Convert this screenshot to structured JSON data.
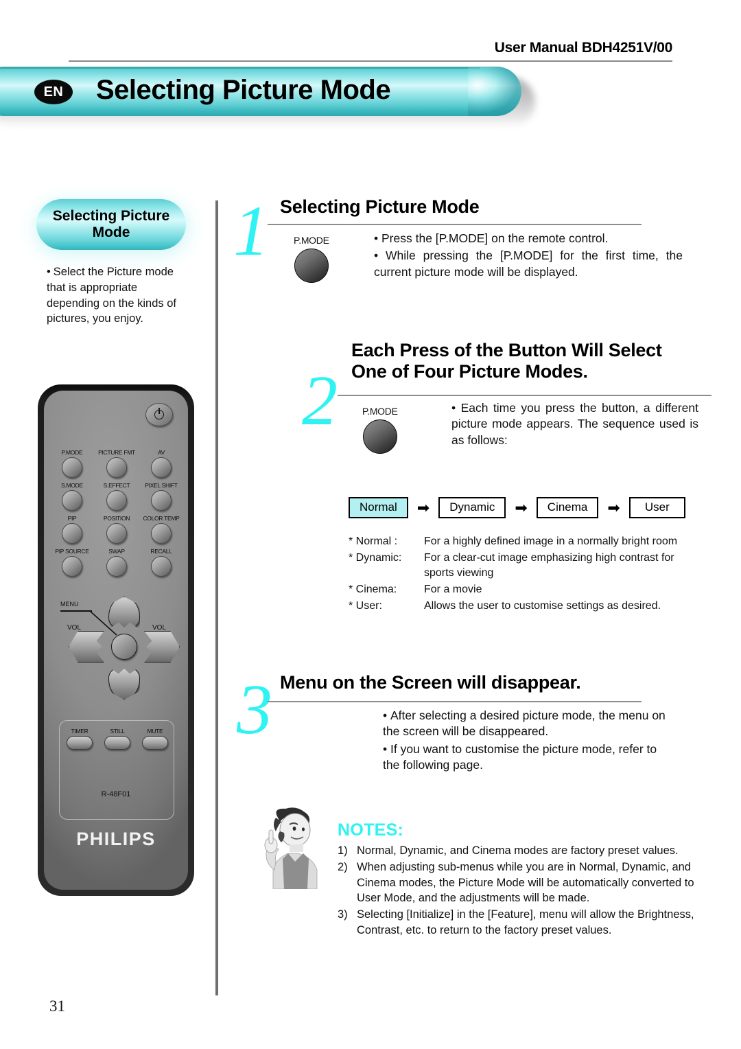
{
  "header": {
    "manual_title": "User Manual BDH4251V/00"
  },
  "banner": {
    "language_badge": "EN",
    "title": "Selecting Picture Mode",
    "accent_color": "#6fd8dc"
  },
  "sidebar": {
    "pill_title": "Selecting Picture Mode",
    "pill_line1": "Selecting Picture",
    "pill_line2": "Mode",
    "bullet": "•",
    "note": "Select the Picture mode that is appropriate depending on the kinds of pictures, you enjoy."
  },
  "remote": {
    "power_icon": "power-icon",
    "model_code": "R-48F01",
    "brand": "PHILIPS",
    "menu_label": "MENU",
    "vol_left_label": "VOL",
    "vol_right_label": "VOL",
    "button_rows": [
      [
        "P.MODE",
        "PICTURE FMT",
        "AV"
      ],
      [
        "S.MODE",
        "S.EFFECT",
        "PIXEL SHIFT"
      ],
      [
        "PIP",
        "POSITION",
        "COLOR TEMP"
      ],
      [
        "PIP SOURCE",
        "SWAP",
        "RECALL"
      ]
    ],
    "bottom_buttons": [
      "TIMER",
      "STILL",
      "MUTE"
    ]
  },
  "steps": [
    {
      "number": "1",
      "heading": "Selecting Picture Mode",
      "button_label": "P.MODE",
      "bullets": [
        "Press the [P.MODE] on the remote control.",
        "While pressing the [P.MODE] for the first time, the current picture mode will be displayed."
      ]
    },
    {
      "number": "2",
      "heading_line1": "Each Press of the Button Will Select",
      "heading_line2": "One of Four Picture Modes.",
      "button_label": "P.MODE",
      "bullets": [
        "Each time you press the button, a different picture mode appears. The sequence used is as follows:"
      ]
    },
    {
      "number": "3",
      "heading": "Menu on the Screen will disappear.",
      "bullets": [
        "After selecting a desired picture mode, the menu on the screen will be disappeared.",
        "If you want to customise the picture mode, refer to the following page."
      ]
    }
  ],
  "sequence": {
    "arrow": "➡",
    "highlight_color": "#b4f0f2",
    "items": [
      {
        "label": "Normal",
        "highlighted": true
      },
      {
        "label": "Dynamic",
        "highlighted": false
      },
      {
        "label": "Cinema",
        "highlighted": false
      },
      {
        "label": "User",
        "highlighted": false
      }
    ]
  },
  "mode_descriptions": [
    {
      "marker": "* Normal :",
      "text": "For a highly defined image in a normally bright room"
    },
    {
      "marker": "* Dynamic:",
      "text": "For a clear-cut image emphasizing high contrast for sports viewing"
    },
    {
      "marker": "* Cinema:",
      "text": "For a movie"
    },
    {
      "marker": "* User:",
      "text": "Allows the user to customise settings as desired."
    }
  ],
  "notes": {
    "title": "NOTES:",
    "title_color": "#2ff3f3",
    "items": [
      {
        "num": "1)",
        "text": "Normal, Dynamic, and Cinema modes are factory preset values."
      },
      {
        "num": "2)",
        "text": "When adjusting sub-menus while you are in Normal, Dynamic, and Cinema modes, the Picture Mode will be automatically converted to User Mode, and the adjustments will be made."
      },
      {
        "num": "3)",
        "text": "Selecting [Initialize] in the [Feature], menu will allow the Brightness, Contrast, etc. to return to the factory preset values."
      }
    ]
  },
  "footer": {
    "page_number": "31"
  }
}
